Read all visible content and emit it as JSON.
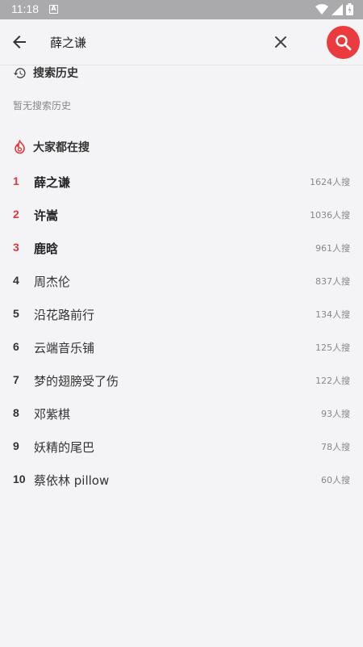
{
  "status_bar": {
    "time": "11:18",
    "notif": "A"
  },
  "search": {
    "value": "薛之谦"
  },
  "history": {
    "title": "搜索历史",
    "empty_text": "暂无搜索历史"
  },
  "hot": {
    "title": "大家都在搜",
    "items": [
      {
        "rank": "1",
        "term": "薛之谦",
        "count": "1624人搜"
      },
      {
        "rank": "2",
        "term": "许嵩",
        "count": "1036人搜"
      },
      {
        "rank": "3",
        "term": "鹿晗",
        "count": "961人搜"
      },
      {
        "rank": "4",
        "term": "周杰伦",
        "count": "837人搜"
      },
      {
        "rank": "5",
        "term": "沿花路前行",
        "count": "134人搜"
      },
      {
        "rank": "6",
        "term": "云端音乐铺",
        "count": "125人搜"
      },
      {
        "rank": "7",
        "term": "梦的翅膀受了伤",
        "count": "122人搜"
      },
      {
        "rank": "8",
        "term": "邓紫棋",
        "count": "93人搜"
      },
      {
        "rank": "9",
        "term": "妖精的尾巴",
        "count": "78人搜"
      },
      {
        "rank": "10",
        "term": "蔡依林 pillow",
        "count": "60人搜"
      }
    ]
  },
  "colors": {
    "accent": "#ea3c3f",
    "background": "#f4f3f6"
  }
}
